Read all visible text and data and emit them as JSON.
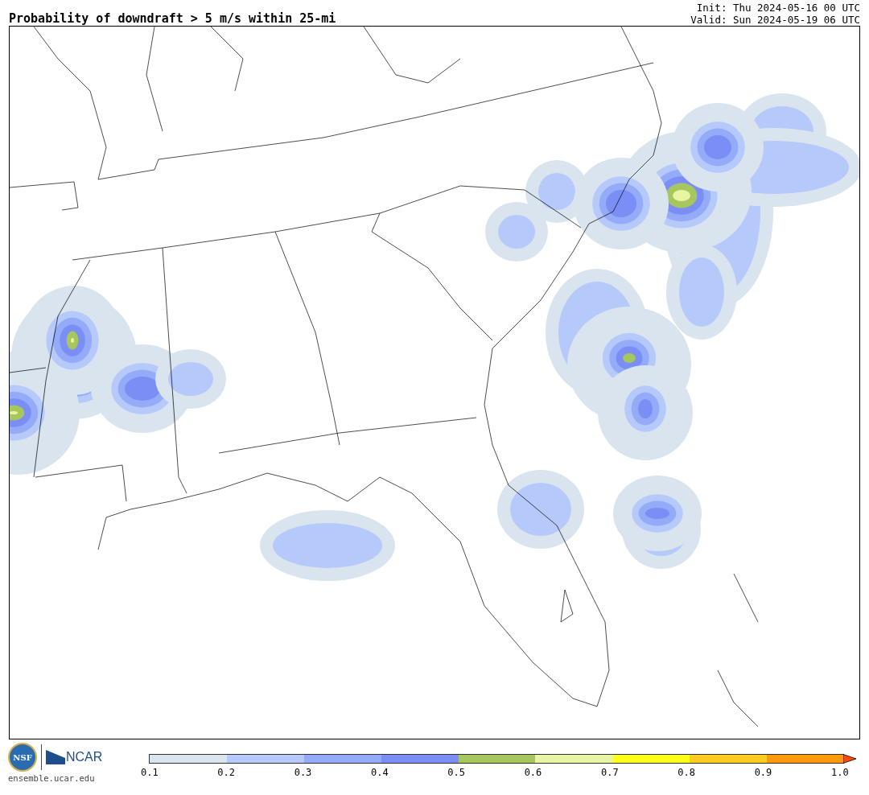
{
  "title": "Probability of downdraft > 5 m/s within 25-mi",
  "init": "Init: Thu 2024-05-16 00 UTC",
  "valid": "Valid: Sun 2024-05-19 06 UTC",
  "logo": {
    "nsf": "NSF",
    "ncar": "NCAR",
    "url": "ensemble.ucar.edu"
  },
  "colorbar": {
    "segments": [
      {
        "kind": "box",
        "color": "#d9e4ef"
      },
      {
        "kind": "box",
        "color": "#b5c9fb"
      },
      {
        "kind": "box",
        "color": "#93abf8"
      },
      {
        "kind": "box",
        "color": "#7b8ef6"
      },
      {
        "kind": "box",
        "color": "#a6c75e"
      },
      {
        "kind": "box",
        "color": "#e8f5a4"
      },
      {
        "kind": "box",
        "color": "#ffff1a"
      },
      {
        "kind": "box",
        "color": "#ffcc22"
      },
      {
        "kind": "box",
        "color": "#ff9a0c"
      },
      {
        "kind": "arrow",
        "color": "#ff4a00"
      }
    ],
    "ticks": [
      "0.1",
      "0.2",
      "0.3",
      "0.4",
      "0.5",
      "0.6",
      "0.7",
      "0.8",
      "0.9",
      "1.0"
    ]
  }
}
